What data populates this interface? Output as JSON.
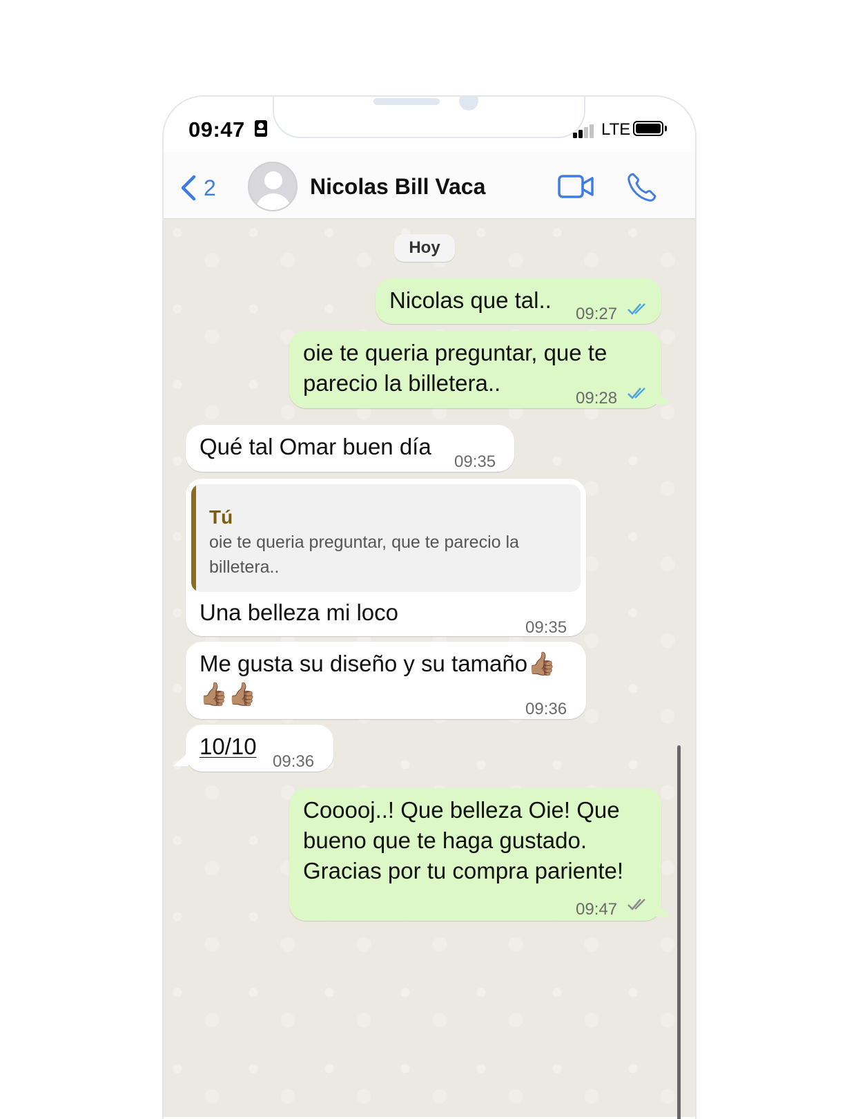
{
  "status_bar": {
    "time": "09:47",
    "network": "LTE"
  },
  "header": {
    "back_count": "2",
    "contact_name": "Nicolas Bill Vaca"
  },
  "chat": {
    "date_chip": "Hoy",
    "messages": [
      {
        "direction": "out",
        "text": "Nicolas que tal..",
        "time": "09:27",
        "status": "read"
      },
      {
        "direction": "out",
        "text": "oie te queria preguntar, que te parecio la billetera..",
        "time": "09:28",
        "status": "read"
      },
      {
        "direction": "in",
        "text": "Qué tal Omar buen día",
        "time": "09:35"
      },
      {
        "direction": "in",
        "quote_author": "Tú",
        "quote_text": "oie te queria preguntar, que te parecio la billetera..",
        "text": "Una belleza mi loco",
        "time": "09:35"
      },
      {
        "direction": "in",
        "text": "Me gusta su diseño y su tamaño👍🏽👍🏽👍🏽",
        "time": "09:36"
      },
      {
        "direction": "in",
        "text": "10/10",
        "time": "09:36"
      },
      {
        "direction": "out",
        "text": "Cooooj..! Que belleza Oie! Que bueno que te haga gustado. Gracias por tu compra pariente!",
        "time": "09:47",
        "status": "delivered"
      }
    ]
  },
  "colors": {
    "accent": "#3f7de3",
    "outgoing_bubble": "#dcf8c6",
    "incoming_bubble": "#ffffff",
    "read_ticks": "#4fa3e0",
    "quote_bar": "#8a6e1e"
  },
  "icons": {
    "back": "chevron-left-icon",
    "video": "video-camera-icon",
    "call": "phone-icon",
    "read": "double-check-icon"
  }
}
